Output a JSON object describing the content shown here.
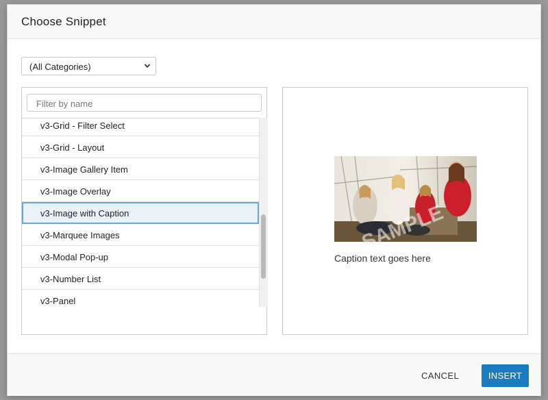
{
  "dialog": {
    "title": "Choose Snippet",
    "category_select": {
      "value": "(All Categories)"
    },
    "filter": {
      "placeholder": "Filter by name"
    },
    "snippets": [
      "v3-Grid - Filter Select",
      "v3-Grid - Layout",
      "v3-Image Gallery Item",
      "v3-Image Overlay",
      "v3-Image with Caption",
      "v3-Marquee Images",
      "v3-Modal Pop-up",
      "v3-Number List",
      "v3-Panel"
    ],
    "selected_snippet": "v3-Image with Caption",
    "preview": {
      "image_watermark": "SAMPLE",
      "caption": "Caption text goes here"
    },
    "buttons": {
      "cancel": "CANCEL",
      "insert": "INSERT"
    }
  },
  "colors": {
    "accent": "#1a7cc0",
    "selected_bg": "#e9f1fa",
    "selected_border": "#6aa7d6"
  }
}
